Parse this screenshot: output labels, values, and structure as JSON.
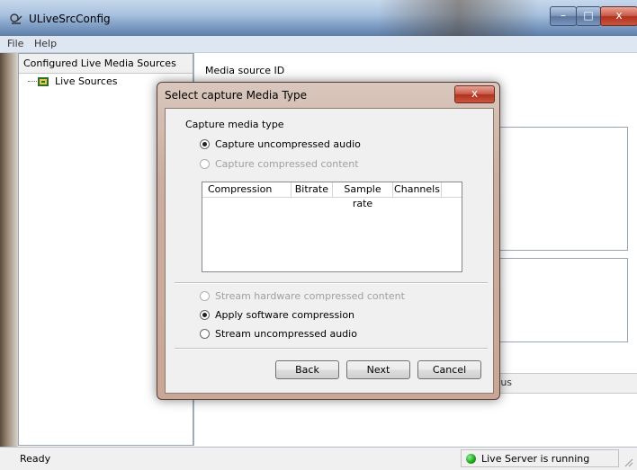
{
  "window": {
    "title": "ULiveSrcConfig",
    "min_icon": "minimize-icon",
    "max_icon": "maximize-icon",
    "close_icon": "close-icon",
    "min_glyph": "–",
    "max_glyph": "□",
    "close_glyph": "x"
  },
  "menu": {
    "file": "File",
    "help": "Help"
  },
  "tree": {
    "header": "Configured Live Media Sources",
    "item_label": "Live Sources"
  },
  "right_pane": {
    "media_source_label": "Media source ID",
    "status_fragment": "tus"
  },
  "statusbar": {
    "left": "Ready",
    "right": "Live Server is running"
  },
  "dialog": {
    "title": "Select capture Media Type",
    "close_glyph": "x",
    "legend": "Capture media type",
    "radios_top": [
      {
        "label": "Capture uncompressed audio",
        "checked": true,
        "disabled": false
      },
      {
        "label": "Capture compressed content",
        "checked": false,
        "disabled": true
      }
    ],
    "columns": [
      "Compression",
      "Bitrate",
      "Sample rate",
      "Channels"
    ],
    "radios_bottom": [
      {
        "label": "Stream hardware compressed content",
        "checked": false,
        "disabled": true
      },
      {
        "label": "Apply software compression",
        "checked": true,
        "disabled": false
      },
      {
        "label": "Stream uncompressed audio",
        "checked": false,
        "disabled": false
      }
    ],
    "buttons": {
      "back": "Back",
      "next": "Next",
      "cancel": "Cancel"
    }
  },
  "colors": {
    "status_ok": "#18a018",
    "close_red": "#c85a48"
  }
}
